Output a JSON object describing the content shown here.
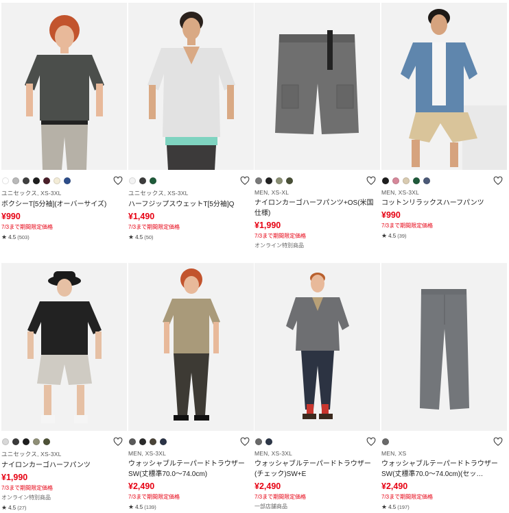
{
  "products": [
    {
      "meta": "ユニセックス, XS-3XL",
      "name": "ボクシーT[5分袖](オーバーサイズ)",
      "price": "¥990",
      "promo": "7/3まで期間限定価格",
      "note": "",
      "rating": "4.5",
      "reviews": "(503)",
      "swatches": [
        "#ffffff",
        "#b9b9b9",
        "#3f3f3f",
        "#1e1e1e",
        "#4a1f29",
        "#f3ecd7",
        "#2d4e8a"
      ]
    },
    {
      "meta": "ユニセックス, XS-3XL",
      "name": "ハーフジップスウェットT[5分袖]Q",
      "price": "¥1,490",
      "promo": "7/3まで期間限定価格",
      "note": "",
      "rating": "4.5",
      "reviews": "(50)",
      "swatches": [
        "#f3f3f3",
        "#3d3d3d",
        "#1f5b3a"
      ]
    },
    {
      "meta": "MEN, XS-XL",
      "name": "ナイロンカーゴハーフパンツ+OS(米国仕様)",
      "price": "¥1,990",
      "promo": "7/3まで期間限定価格",
      "note": "オンライン特別商品",
      "rating": "",
      "reviews": "",
      "swatches": [
        "#7a7a7a",
        "#222222",
        "#8a8f73",
        "#4a5137"
      ]
    },
    {
      "meta": "MEN, XS-3XL",
      "name": "コットンリラックスハーフパンツ",
      "price": "¥990",
      "promo": "7/3まで期間限定価格",
      "note": "",
      "rating": "4.5",
      "reviews": "(39)",
      "swatches": [
        "#1e1e1e",
        "#d6889a",
        "#d9cbb1",
        "#1f5a3b",
        "#4c5a78"
      ]
    },
    {
      "meta": "ユニセックス, XS-3XL",
      "name": "ナイロンカーゴハーフパンツ",
      "price": "¥1,990",
      "promo": "7/3まで期間限定価格",
      "note": "オンライン特別商品",
      "rating": "4.5",
      "reviews": "(27)",
      "swatches": [
        "#d8d8d8",
        "#3a3a3a",
        "#1e1e1e",
        "#8f8f77",
        "#4e5237"
      ]
    },
    {
      "meta": "MEN, XS-3XL",
      "name": "ウォッシャブルテーパードトラウザーSW(丈標準70.0〜74.0cm)",
      "price": "¥2,490",
      "promo": "7/3まで期間限定価格",
      "note": "",
      "rating": "4.5",
      "reviews": "(139)",
      "swatches": [
        "#5a5a5a",
        "#2b2b2b",
        "#4a4438",
        "#2b3447"
      ]
    },
    {
      "meta": "MEN, XS-3XL",
      "name": "ウォッシャブルテーパードトラウザー(チェック)SW+E",
      "price": "¥2,490",
      "promo": "7/3まで期間限定価格",
      "note": "一部店舗商品",
      "rating": "",
      "reviews": "",
      "swatches": [
        "#6a6a6a",
        "#2d3748"
      ]
    },
    {
      "meta": "MEN, XS",
      "name": "ウォッシャブルテーパードトラウザーSW(丈標準70.0〜74.0cm)(セッ…",
      "price": "¥2,490",
      "promo": "7/3まで期間限定価格",
      "note": "",
      "rating": "4.5",
      "reviews": "(197)",
      "swatches": [
        "#6a6a6a"
      ]
    }
  ]
}
